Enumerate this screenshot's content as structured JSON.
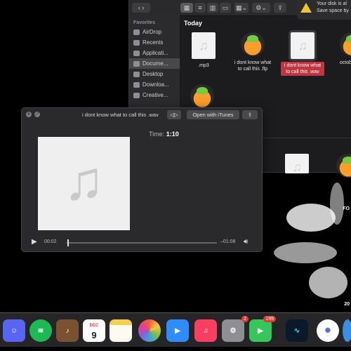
{
  "finder": {
    "section_header": "Favorites",
    "sidebar": [
      {
        "label": "AirDrop",
        "icon": "airdrop-icon",
        "active": false
      },
      {
        "label": "Recents",
        "icon": "clock-icon",
        "active": false
      },
      {
        "label": "Applicati...",
        "icon": "applications-icon",
        "active": false
      },
      {
        "label": "Docume...",
        "icon": "document-icon",
        "active": true
      },
      {
        "label": "Desktop",
        "icon": "desktop-icon",
        "active": false
      },
      {
        "label": "Downloa...",
        "icon": "download-icon",
        "active": false
      },
      {
        "label": "Creative...",
        "icon": "folder-icon",
        "active": false
      }
    ],
    "group_title": "Today",
    "files": [
      {
        "label": ".mp3",
        "type": "audio",
        "selected": false
      },
      {
        "label": "i dont know what to call this .flp",
        "type": "flstudio",
        "selected": false
      },
      {
        "label": "i dont know what to call this .wav",
        "type": "audio",
        "selected": true
      },
      {
        "label": "october.fl...",
        "type": "flstudio",
        "selected": false
      }
    ]
  },
  "notification": {
    "line1": "Your disk is al",
    "line2": "Save space by"
  },
  "quicklook": {
    "title": "i dont know what to call this .wav",
    "open_button": "Open with iTunes",
    "time_label": "Time:",
    "time_value": "1:10",
    "elapsed": "00:02",
    "remaining": "–01:08"
  },
  "dock": {
    "calendar_month": "DEC",
    "calendar_day": "9",
    "system_prefs_badge": "2",
    "facetime_badge": "199",
    "apps": [
      "discord-icon",
      "spotify-icon",
      "garageband-icon",
      "calendar-icon",
      "notes-icon",
      "photos-icon",
      "zoom-icon",
      "music-icon",
      "system-preferences-icon",
      "facetime-icon",
      "siri-icon",
      "settings-icon",
      "browser-icon"
    ]
  },
  "desktop_text": {
    "corner1": "FO",
    "corner2": "20"
  },
  "colors": {
    "selection": "#c0353f",
    "accent": "#1f6feb"
  }
}
